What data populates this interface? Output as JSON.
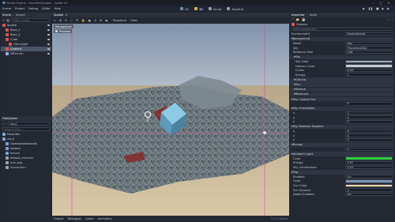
{
  "window": {
    "title": "Godot Engine - OpenSkyScapes - Godot v3"
  },
  "menu": [
    "Scene",
    "Project",
    "Debug",
    "Editor",
    "Help"
  ],
  "workspace": {
    "2d": "2D",
    "3d": "3D",
    "script": "Script",
    "assetlib": "AssetLib"
  },
  "scene_dock": {
    "tabs": [
      "Scene",
      "Import"
    ],
    "filter_placeholder": "Filter nodes",
    "nodes": [
      {
        "label": "Spatial",
        "depth": 0,
        "color": "#e0544c"
      },
      {
        "label": "Rock_1",
        "depth": 1,
        "color": "#e0544c"
      },
      {
        "label": "Rock_2",
        "depth": 1,
        "color": "#e0544c"
      },
      {
        "label": "Cube",
        "depth": 1,
        "color": "#e0544c"
      },
      {
        "label": "OmniLight",
        "depth": 2,
        "color": "#e0544c"
      },
      {
        "label": "Camera",
        "depth": 1,
        "color": "#e0544c"
      },
      {
        "label": "WEnv.tsh",
        "depth": 1,
        "color": "#8fb3e8"
      }
    ],
    "selected_index": 5
  },
  "filesystem_dock": {
    "title": "FileSystem",
    "path": "res://",
    "search_placeholder": "Search files",
    "items": [
      {
        "label": "Favorites",
        "depth": 0
      },
      {
        "label": "res://",
        "depth": 0
      },
      {
        "label": "DownloadedAssets",
        "depth": 1
      },
      {
        "label": "addons",
        "depth": 1
      },
      {
        "label": "terrain",
        "depth": 1
      },
      {
        "label": "default_env.tres",
        "depth": 1
      },
      {
        "label": "icon.png",
        "depth": 1
      },
      {
        "label": "Scene.tscn",
        "depth": 1
      }
    ]
  },
  "viewport": {
    "tab": "Spatial",
    "toolbar": {
      "transform": "Transform",
      "view": "View"
    },
    "perspective_label": "Perspective",
    "preview_label": "Preview"
  },
  "bottom_panel": {
    "tabs": [
      "Output",
      "Debugger",
      "Audio",
      "Animation"
    ],
    "version": "3.2.1.stable"
  },
  "inspector": {
    "tabs": [
      "Inspector",
      "Node"
    ],
    "node_name": "Camera",
    "filter_placeholder": "Filter properties",
    "resource": "Environment",
    "sections": [
      {
        "title": "Background",
        "props": [
          [
            "Mode",
            "Sky"
          ],
          [
            "Sky",
            "ProceduralSky"
          ],
          [
            "Radiance Size",
            "128"
          ]
        ]
      },
      {
        "title": "Sky",
        "sub": true,
        "props": [
          [
            "Sky Color",
            ""
          ],
          [
            "Horizon Color",
            ""
          ],
          [
            "Curve",
            "0.09"
          ],
          [
            "Energy",
            "1"
          ]
        ]
      },
      {
        "title": "Ground",
        "sub": true,
        "props": []
      },
      {
        "title": "Sun",
        "sub": true,
        "props": []
      },
      {
        "title": "Texture",
        "sub": true,
        "props": []
      },
      {
        "title": "Resource",
        "sub": true,
        "props": []
      },
      {
        "title": "Sky Custom Fov",
        "props": [
          [
            "",
            "0"
          ]
        ]
      },
      {
        "title": "Sky Orientation",
        "props": [
          [
            "x",
            "1"
          ],
          [
            "y",
            "0"
          ],
          [
            "z",
            "0"
          ]
        ]
      },
      {
        "title": "Sky Rotation Degrees",
        "props": [
          [
            "x",
            "0"
          ],
          [
            "y",
            "0"
          ],
          [
            "z",
            "0"
          ]
        ]
      },
      {
        "title": "Energy",
        "props": [
          [
            "",
            "1"
          ]
        ]
      },
      {
        "title": "Ambient Light",
        "props": [
          [
            "Color",
            ""
          ],
          [
            "Energy",
            "0.67"
          ],
          [
            "Sky Contribution",
            "0.31"
          ]
        ]
      },
      {
        "title": "Fog",
        "props": [
          [
            "Enabled",
            "On"
          ],
          [
            "Color",
            ""
          ],
          [
            "Sun Color",
            ""
          ],
          [
            "Sun Amount",
            "0"
          ],
          [
            "Depth Enabled",
            "On"
          ]
        ]
      }
    ],
    "colors": {
      "Sky Color": "#9aa6b4",
      "Horizon Color": "#c6ccd4",
      "Color": "#2ecc3a",
      "Sun Color": "#f0d8a8",
      "Fog Color": "#7a93b0"
    }
  },
  "accent": "#5e9ce0"
}
